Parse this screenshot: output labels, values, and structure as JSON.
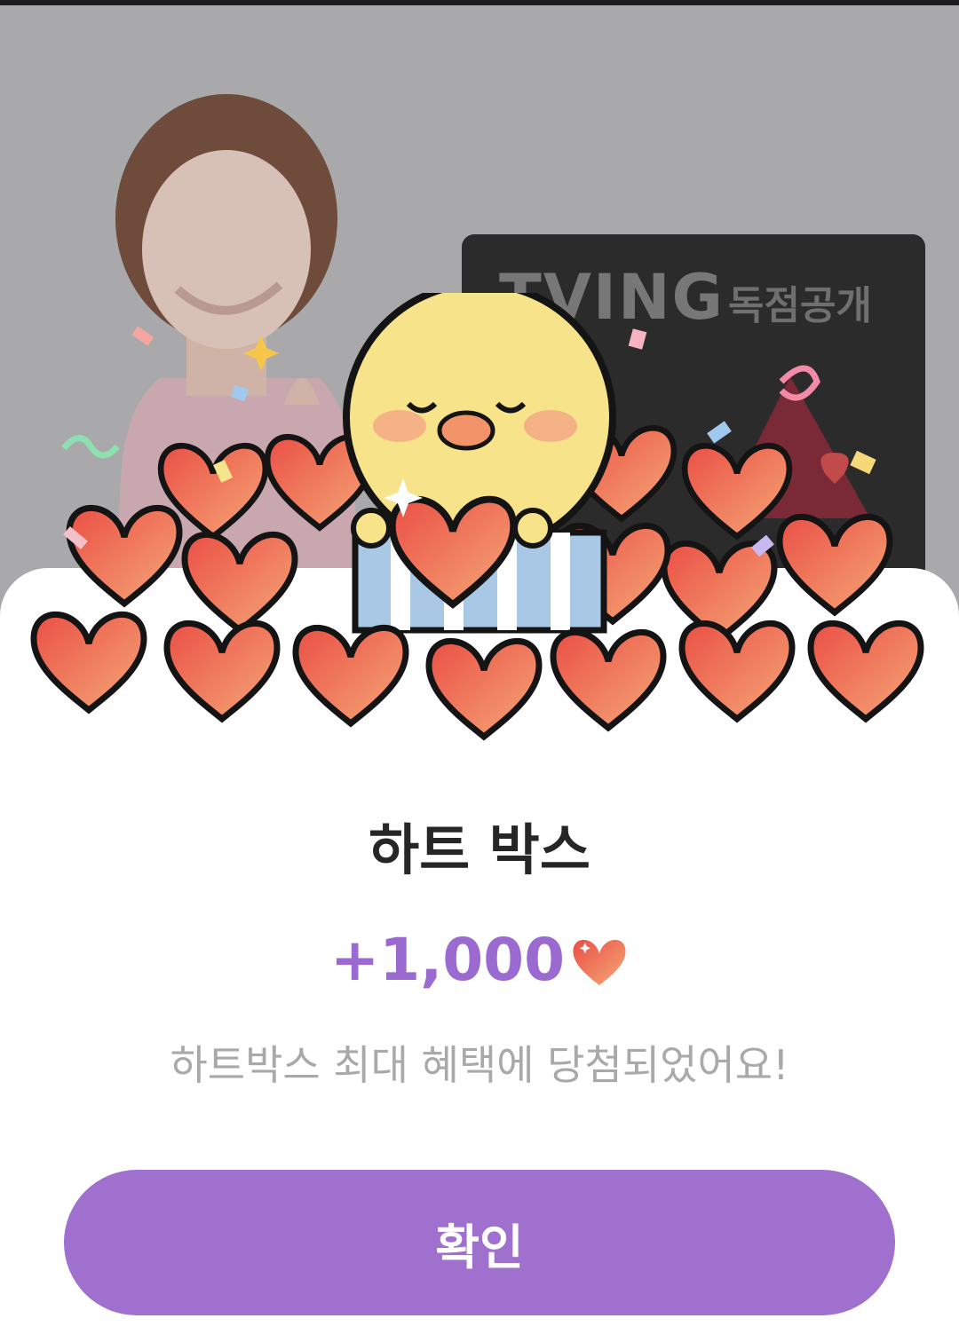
{
  "promo": {
    "brand": "TVING",
    "tag": "독점공개"
  },
  "dialog": {
    "title": "하트 박스",
    "reward_amount": "+1,000",
    "reward_icon": "heart-icon",
    "message": "하트박스 최대 혜택에 당첨되었어요!",
    "confirm_label": "확인"
  },
  "colors": {
    "accent": "#a070cf",
    "reward_text": "#9b6ad0",
    "heart": "#ef6a4c",
    "title_text": "#262626",
    "message_text": "#a9a9a9"
  }
}
